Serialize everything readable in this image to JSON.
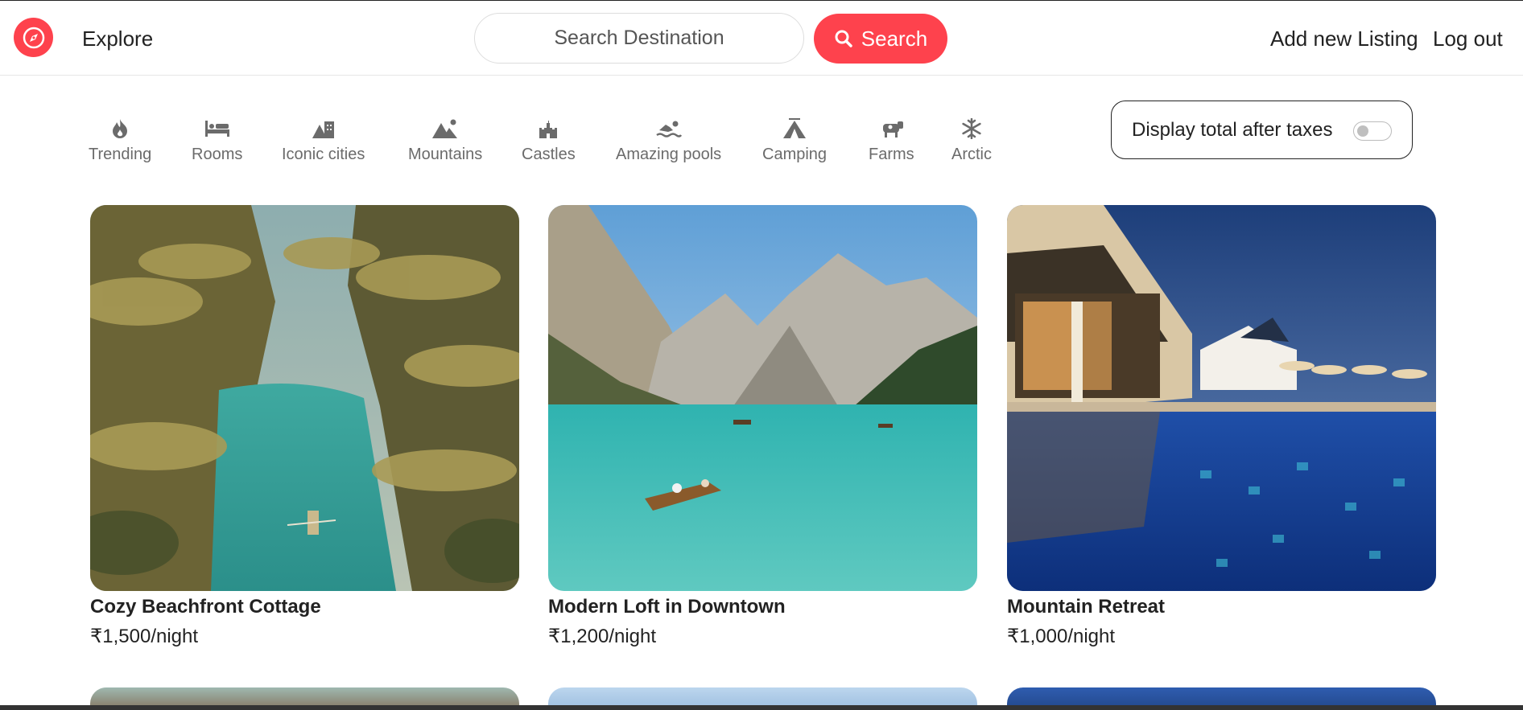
{
  "navbar": {
    "explore_label": "Explore",
    "search_placeholder": "Search Destination",
    "search_button_label": "Search",
    "add_listing_label": "Add new Listing",
    "logout_label": "Log out",
    "brand_color": "#fe424d"
  },
  "filters": [
    {
      "label": "Trending",
      "icon": "fire-icon"
    },
    {
      "label": "Rooms",
      "icon": "bed-icon"
    },
    {
      "label": "Iconic cities",
      "icon": "city-icon"
    },
    {
      "label": "Mountains",
      "icon": "mountain-icon"
    },
    {
      "label": "Castles",
      "icon": "castle-icon"
    },
    {
      "label": "Amazing pools",
      "icon": "swimmer-icon"
    },
    {
      "label": "Camping",
      "icon": "tent-icon"
    },
    {
      "label": "Farms",
      "icon": "cow-icon"
    },
    {
      "label": "Arctic",
      "icon": "snowflake-icon"
    }
  ],
  "tax_toggle": {
    "label": "Display total after taxes",
    "enabled": false
  },
  "listings": [
    {
      "title": "Cozy Beachfront Cottage",
      "price": "₹1,500/night"
    },
    {
      "title": "Modern Loft in Downtown",
      "price": "₹1,200/night"
    },
    {
      "title": "Mountain Retreat",
      "price": "₹1,000/night"
    }
  ]
}
